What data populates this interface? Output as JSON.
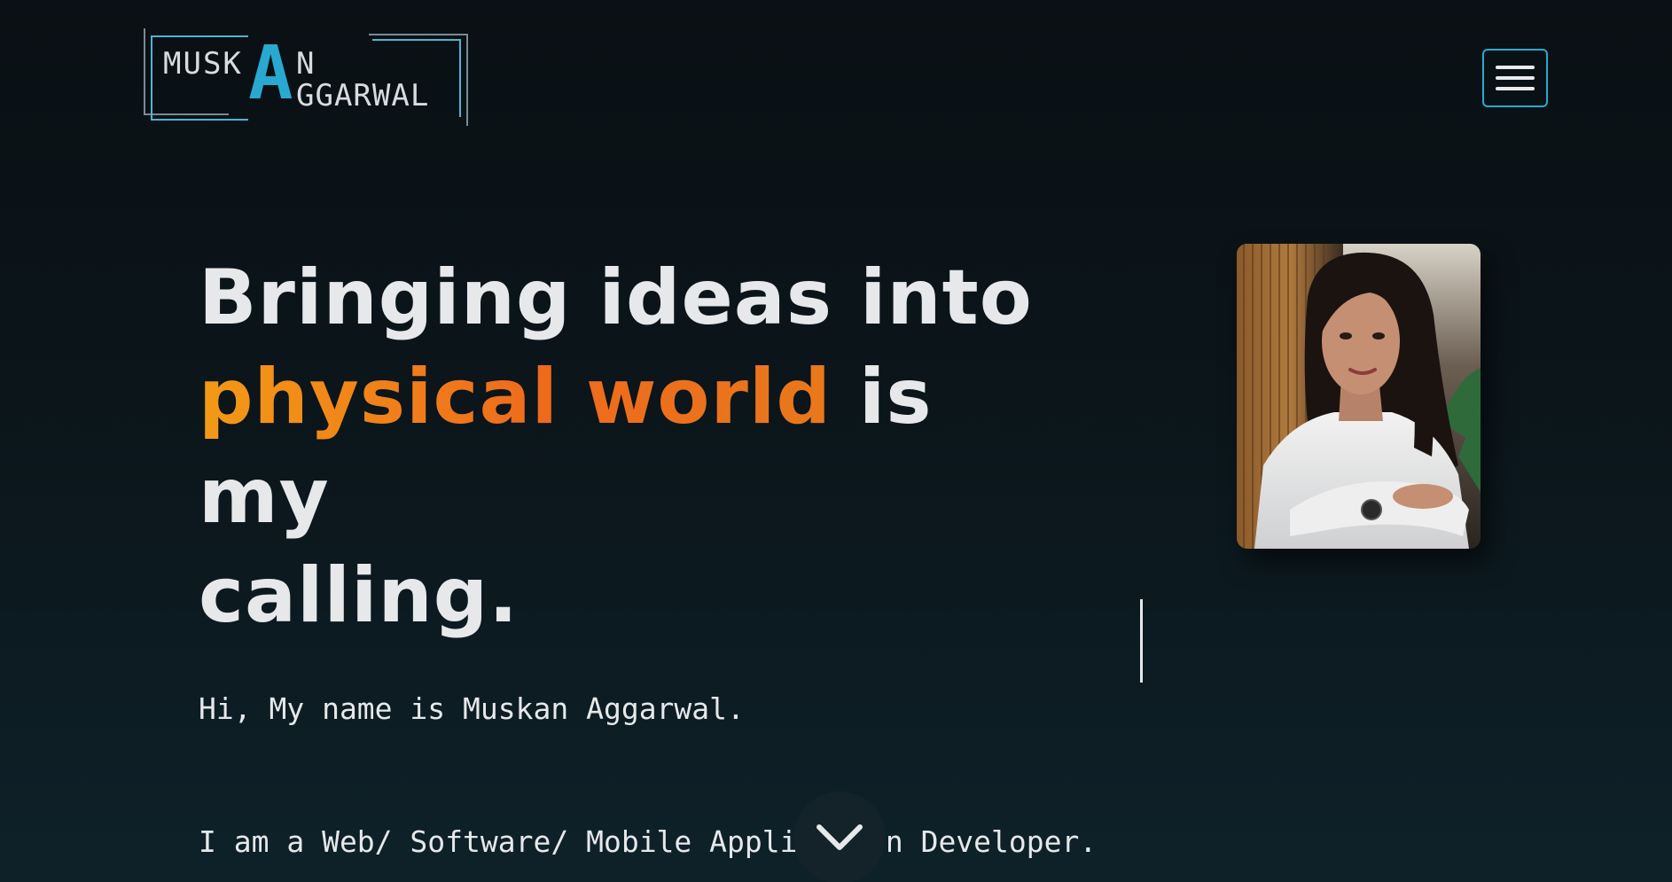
{
  "logo": {
    "first_name_prefix": "MUSK",
    "big_letter": "A",
    "first_name_suffix": "N",
    "last_name_rest": "GGARWAL"
  },
  "hero": {
    "line1": "Bringing ideas into",
    "accent": "physical world",
    "line2_rest": " is my",
    "line3": "calling.",
    "intro_line1": "Hi, My name is Muskan Aggarwal.",
    "intro_line2": "I am a Web/ Software/ Mobile Application Developer."
  },
  "icons": {
    "menu": "hamburger-icon",
    "scroll": "chevron-down-icon"
  },
  "colors": {
    "accent_blue": "#29a9cf",
    "accent_orange_start": "#f39a16",
    "accent_orange_end": "#ee6a1d",
    "background": "#0a1014",
    "text": "#e6e8ea"
  }
}
